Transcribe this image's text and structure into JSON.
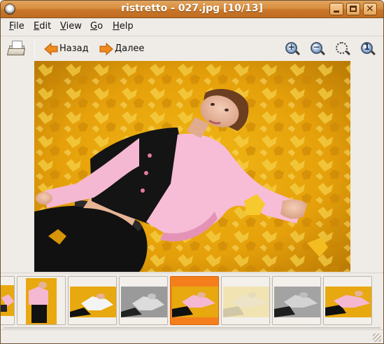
{
  "window": {
    "title": "ristretto - 027.jpg [10/13]",
    "colors": {
      "titlebar": "#d98e3e",
      "selected_thumb": "#f47e1b",
      "background": "#efebe7"
    }
  },
  "menubar": {
    "items": [
      {
        "label": "File",
        "mnemonic": "F",
        "rest": "ile"
      },
      {
        "label": "Edit",
        "mnemonic": "E",
        "rest": "dit"
      },
      {
        "label": "View",
        "mnemonic": "V",
        "rest": "iew"
      },
      {
        "label": "Go",
        "mnemonic": "G",
        "rest": "o"
      },
      {
        "label": "Help",
        "mnemonic": "H",
        "rest": "elp"
      }
    ]
  },
  "toolbar": {
    "open_icon": "folder-open-icon",
    "back_label": "Назад",
    "forward_label": "Далее",
    "zoom_in_icon": "zoom-in-icon",
    "zoom_out_icon": "zoom-out-icon",
    "zoom_fit_icon": "zoom-fit-icon",
    "zoom_100_icon": "zoom-100-icon",
    "zoom_in_symbol": "+",
    "zoom_out_symbol": "−",
    "zoom_100_symbol": "1"
  },
  "thumbnails": {
    "selected_index": 4,
    "items": [
      {
        "variant": "color"
      },
      {
        "variant": "color"
      },
      {
        "variant": "color-jacket-white"
      },
      {
        "variant": "grayscale"
      },
      {
        "variant": "color-selected"
      },
      {
        "variant": "faded-sepia"
      },
      {
        "variant": "grayscale"
      },
      {
        "variant": "color"
      }
    ]
  },
  "statusbar": {
    "text": ""
  }
}
